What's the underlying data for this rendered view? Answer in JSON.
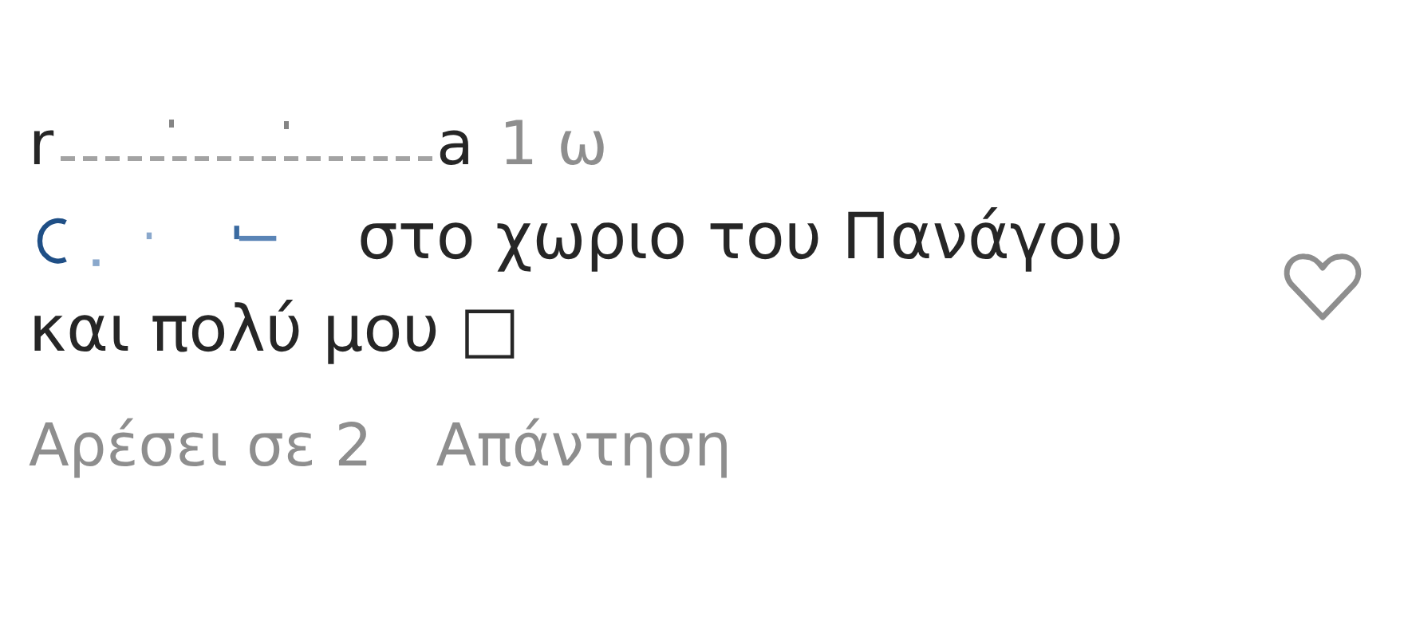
{
  "comment": {
    "username_start": "r",
    "username_end": "a",
    "time": "1 ω",
    "text_lines": [
      "στο χωριο του Πανάγου",
      "και πολύ μου □"
    ],
    "liked": false,
    "actions": [
      {
        "kind": "likes",
        "label": "Αρέσει σε 2"
      },
      {
        "kind": "reply",
        "label": "Απάντηση"
      }
    ]
  }
}
